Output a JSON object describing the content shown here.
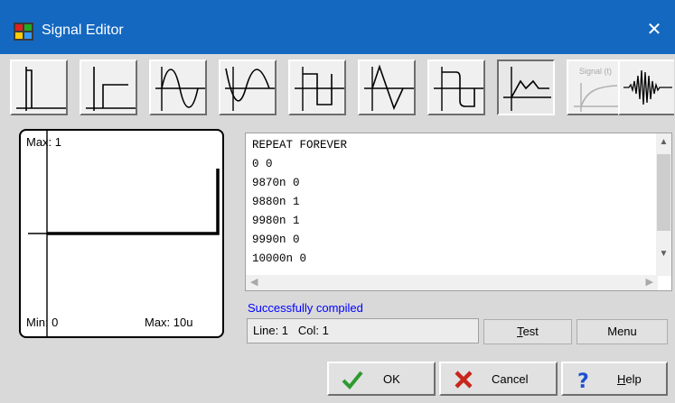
{
  "window": {
    "title": "Signal Editor",
    "close_glyph": "✕"
  },
  "toolbar": {
    "buttons": [
      {
        "name": "step-signal",
        "icon": "step-icon"
      },
      {
        "name": "delayed-step-signal",
        "icon": "delayed-step-icon"
      },
      {
        "name": "sine-signal",
        "icon": "sine-icon"
      },
      {
        "name": "inverted-sine-signal",
        "icon": "inverted-sine-icon"
      },
      {
        "name": "square-signal",
        "icon": "square-wave-icon"
      },
      {
        "name": "triangle-signal",
        "icon": "triangle-wave-icon"
      },
      {
        "name": "rounded-pulse-signal",
        "icon": "rounded-pulse-icon"
      },
      {
        "name": "custom-pwl-signal",
        "icon": "piecewise-linear-icon",
        "pressed": true
      },
      {
        "name": "signal-t-function",
        "icon": "function-curve-icon",
        "label": "Signal (t)",
        "disabled": true
      },
      {
        "name": "noise-signal",
        "icon": "burst-wave-icon"
      }
    ]
  },
  "preview": {
    "max_label": "Max: 1",
    "min_label": "Min: 0",
    "time_max_label": "Max: 10u"
  },
  "editor": {
    "lines": [
      "REPEAT FOREVER",
      "0 0",
      "9870n 0",
      "9880n 1",
      "9980n 1",
      "9990n 0",
      "10000n 0"
    ],
    "text": "REPEAT FOREVER\n0 0\n9870n 0\n9880n 1\n9980n 1\n9990n 0\n10000n 0"
  },
  "status": {
    "message": "Successfully compiled",
    "line_col": "Line: 1   Col: 1"
  },
  "buttons": {
    "test_label_u": "T",
    "test_label_rest": "est",
    "menu_label": "Menu",
    "ok_label": "OK",
    "cancel_label": "Cancel",
    "help_label_u": "H",
    "help_label_rest": "elp"
  },
  "colors": {
    "titlebar": "#1468c0",
    "status_text": "#0000ff",
    "ok_check": "#2e9a2e",
    "cancel_x": "#c8261c",
    "help_q": "#1e4fd1"
  }
}
